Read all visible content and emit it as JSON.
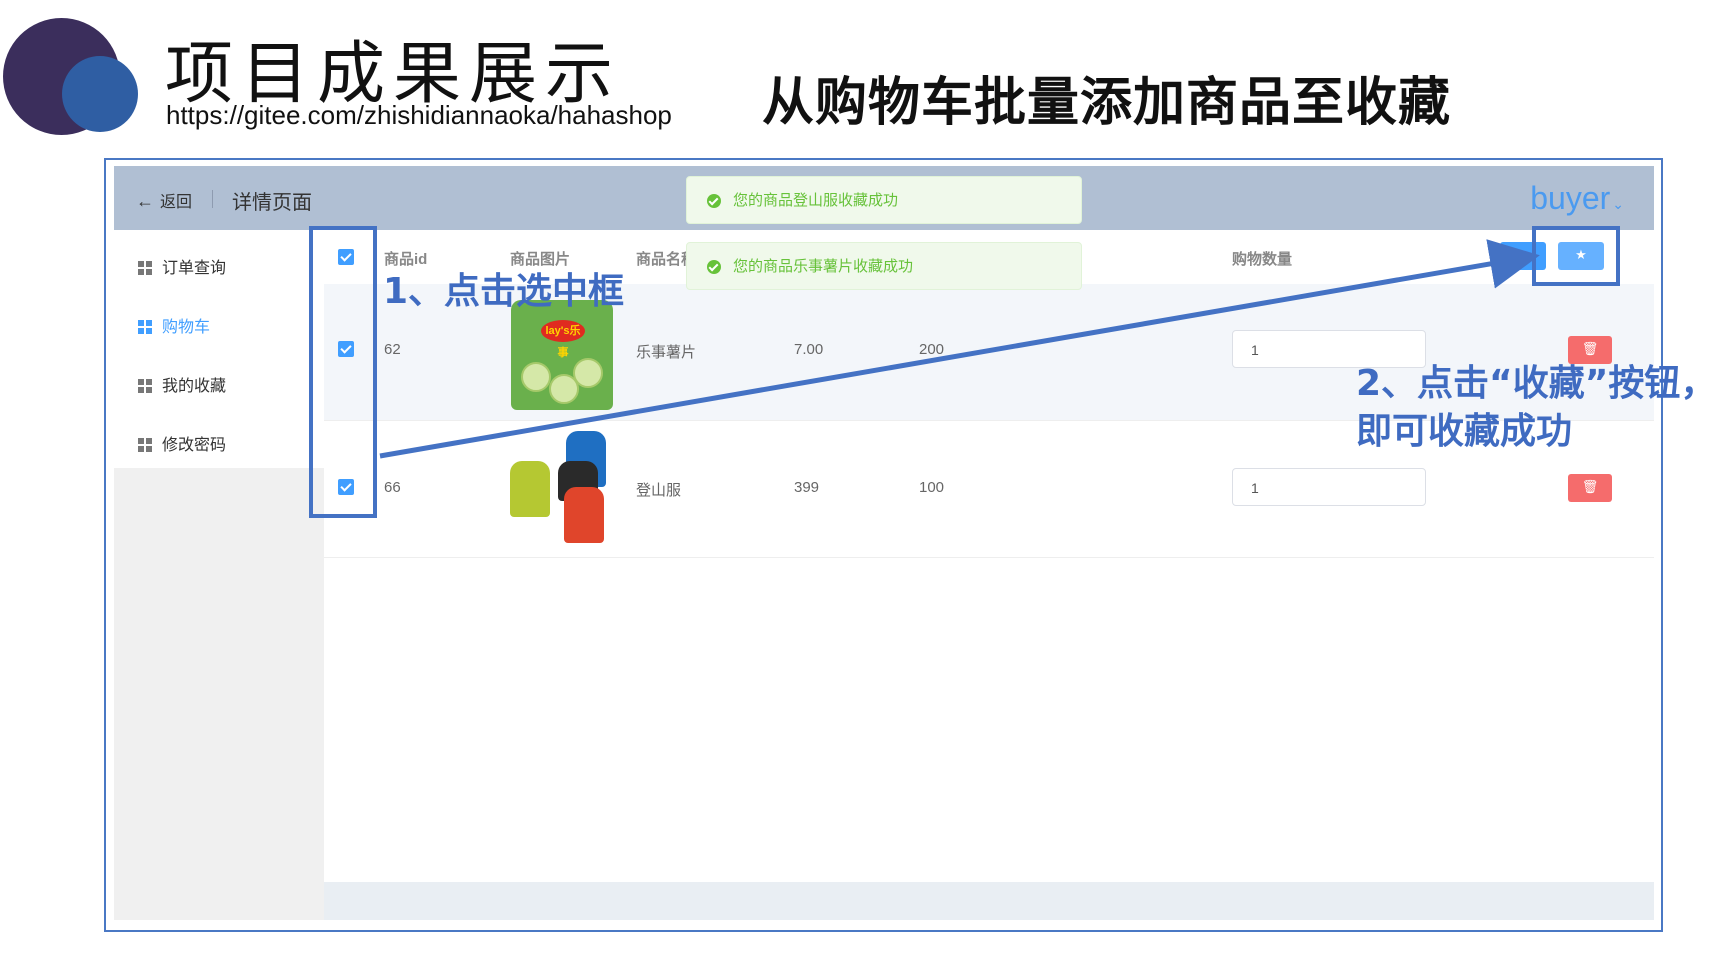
{
  "slide": {
    "title": "项目成果展示",
    "url": "https://gitee.com/zhishidiannaoka/hahashop",
    "subtitle": "从购物车批量添加商品至收藏"
  },
  "app": {
    "back_label": "返回",
    "page_title": "详情页面",
    "user": "buyer",
    "sidebar": {
      "items": [
        {
          "label": "订单查询"
        },
        {
          "label": "购物车"
        },
        {
          "label": "我的收藏"
        },
        {
          "label": "修改密码"
        }
      ]
    },
    "table": {
      "headers": {
        "id": "商品id",
        "image": "商品图片",
        "name": "商品名称",
        "quantity": "购物数量"
      },
      "rows": [
        {
          "id": "62",
          "name": "乐事薯片",
          "price": "7.00",
          "stock": "200",
          "quantity": "1"
        },
        {
          "id": "66",
          "name": "登山服",
          "price": "399",
          "stock": "100",
          "quantity": "1"
        }
      ],
      "delete_icon": "trash-icon",
      "favorite_icon": "star-icon",
      "chips_logo": "lay's乐事"
    },
    "toasts": [
      "您的商品登山服收藏成功",
      "您的商品乐事薯片收藏成功"
    ]
  },
  "annotations": {
    "step1": "1、点击选中框",
    "step2_line1": "2、点击“收藏”按钮，",
    "step2_line2": "即可收藏成功"
  },
  "colors": {
    "header_bg": "#b0bfd3",
    "accent": "#409eff",
    "danger": "#f56c6c",
    "success": "#67c23a",
    "annotation": "#4472c4"
  }
}
